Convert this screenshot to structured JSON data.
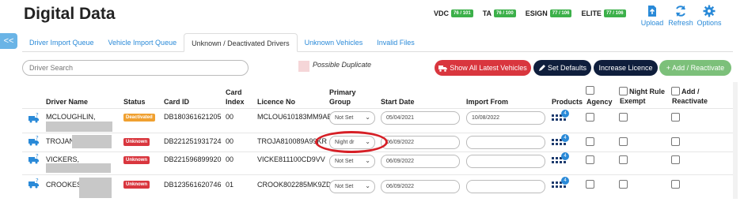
{
  "page": {
    "title": "Digital Data"
  },
  "counters": [
    {
      "name": "VDC",
      "badge": "76 / 101"
    },
    {
      "name": "TA",
      "badge": "76 / 100"
    },
    {
      "name": "ESIGN",
      "badge": "77 / 106"
    },
    {
      "name": "ELITE",
      "badge": "77 / 106"
    }
  ],
  "top_actions": {
    "upload": "Upload",
    "refresh": "Refresh",
    "options": "Options",
    "back": "<<"
  },
  "tabs": [
    "Driver Import Queue",
    "Vehicle Import Queue",
    "Unknown / Deactivated Drivers",
    "Unknown Vehicles",
    "Invalid Files"
  ],
  "search": {
    "placeholder": "Driver Search"
  },
  "legend": {
    "possible_duplicate": "Possible Duplicate"
  },
  "buttons": {
    "show_vehicles": "Show All Latest Vehicles",
    "set_defaults": "Set Defaults",
    "increase_licence": "Increase Licence",
    "add_reactivate": "+ Add / Reactivate"
  },
  "colors": {
    "accent": "#2a8ad8",
    "red_button": "#d9363e",
    "navy_button": "#0f1e3c",
    "green_button": "#7cc07a",
    "deactivated": "#f0a030",
    "unknown": "#d9363e",
    "badge_green": "#3cb04a",
    "annotation": "#d61f26"
  },
  "columns": {
    "driver_name": "Driver Name",
    "status": "Status",
    "card_id": "Card ID",
    "card_index": "Card Index",
    "licence_no": "Licence No",
    "primary_group": "Primary Group",
    "start_date": "Start Date",
    "import_from": "Import From",
    "products": "Products",
    "agency": "Agency",
    "night_rule": "Night Rule Exempt",
    "add_reactivate": "Add / Reactivate"
  },
  "rows": [
    {
      "name": "MCLOUGHLIN,",
      "status": "Deactivated",
      "card_id": "DB180361621205",
      "card_index": "00",
      "licence": "MCLOU610183MM9AB",
      "group": "Not Set",
      "start_date": "05/04/2021",
      "import_from": "10/08/2022",
      "products": "4"
    },
    {
      "name": "TROJAN",
      "status": "Unknown",
      "card_id": "DB221251931724",
      "card_index": "00",
      "licence": "TROJA810089A99KR",
      "group": "Night dr",
      "start_date": "06/09/2022",
      "import_from": "",
      "products": "4"
    },
    {
      "name": "VICKERS,",
      "status": "Unknown",
      "card_id": "DB221596899920",
      "card_index": "00",
      "licence": "VICKE811100CD9VV",
      "group": "Not Set",
      "start_date": "06/09/2022",
      "import_from": "",
      "products": "4"
    },
    {
      "name": "CROOKES,",
      "status": "Unknown",
      "card_id": "DB123561620746",
      "card_index": "01",
      "licence": "CROOK802285MK9ZD",
      "group": "Not Set",
      "start_date": "06/09/2022",
      "import_from": "",
      "products": "4"
    }
  ]
}
